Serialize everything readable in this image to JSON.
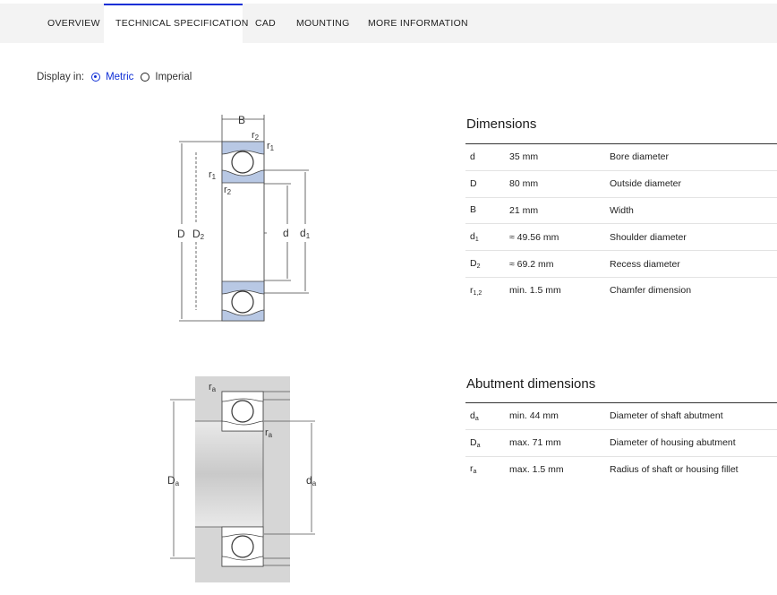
{
  "tabs": [
    {
      "label": "OVERVIEW",
      "active": false
    },
    {
      "label": "TECHNICAL SPECIFICATION",
      "active": true
    },
    {
      "label": "CAD",
      "active": false
    },
    {
      "label": "MOUNTING",
      "active": false
    },
    {
      "label": "MORE INFORMATION",
      "active": false
    }
  ],
  "display": {
    "label": "Display in:",
    "options": [
      {
        "label": "Metric",
        "selected": true
      },
      {
        "label": "Imperial",
        "selected": false
      }
    ]
  },
  "dimensions": {
    "title": "Dimensions",
    "rows": [
      {
        "sym": "d",
        "sub": "",
        "value": "35 mm",
        "desc": "Bore diameter"
      },
      {
        "sym": "D",
        "sub": "",
        "value": "80 mm",
        "desc": "Outside diameter"
      },
      {
        "sym": "B",
        "sub": "",
        "value": "21 mm",
        "desc": "Width"
      },
      {
        "sym": "d",
        "sub": "1",
        "value": "≈ 49.56 mm",
        "desc": "Shoulder diameter"
      },
      {
        "sym": "D",
        "sub": "2",
        "value": "≈ 69.2 mm",
        "desc": "Recess diameter"
      },
      {
        "sym": "r",
        "sub": "1,2",
        "value": "min. 1.5 mm",
        "desc": "Chamfer dimension"
      }
    ]
  },
  "abutment": {
    "title": "Abutment dimensions",
    "rows": [
      {
        "sym": "d",
        "sub": "a",
        "value": "min. 44 mm",
        "desc": "Diameter of shaft abutment"
      },
      {
        "sym": "D",
        "sub": "a",
        "value": "max. 71 mm",
        "desc": "Diameter of housing abutment"
      },
      {
        "sym": "r",
        "sub": "a",
        "value": "max. 1.5 mm",
        "desc": "Radius of shaft or housing fillet"
      }
    ]
  },
  "drawing_labels": {
    "B": "B",
    "r2_top": "r",
    "r2_top_sub": "2",
    "r1_top": "r",
    "r1_top_sub": "1",
    "r1_left": "r",
    "r1_left_sub": "1",
    "r2_left": "r",
    "r2_left_sub": "2",
    "D": "D",
    "D2": "D",
    "D2_sub": "2",
    "d": "d",
    "d1": "d",
    "d1_sub": "1",
    "ra_top": "r",
    "ra_top_sub": "a",
    "ra_mid": "r",
    "ra_mid_sub": "a",
    "Da": "D",
    "Da_sub": "a",
    "da": "d",
    "da_sub": "a"
  }
}
